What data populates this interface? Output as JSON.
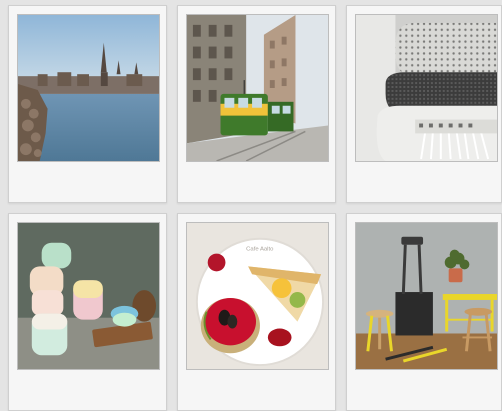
{
  "gallery": {
    "items": [
      {
        "id": "harbor",
        "caption": "",
        "icon": "harbor-photo"
      },
      {
        "id": "tram",
        "caption": "",
        "icon": "tram-photo"
      },
      {
        "id": "blankets",
        "caption": "",
        "icon": "blankets-photo"
      },
      {
        "id": "cups",
        "caption": "",
        "icon": "cups-photo"
      },
      {
        "id": "dessert",
        "caption": "Cafe Aalto",
        "icon": "dessert-photo"
      },
      {
        "id": "stools",
        "caption": "",
        "icon": "stools-photo"
      }
    ]
  }
}
